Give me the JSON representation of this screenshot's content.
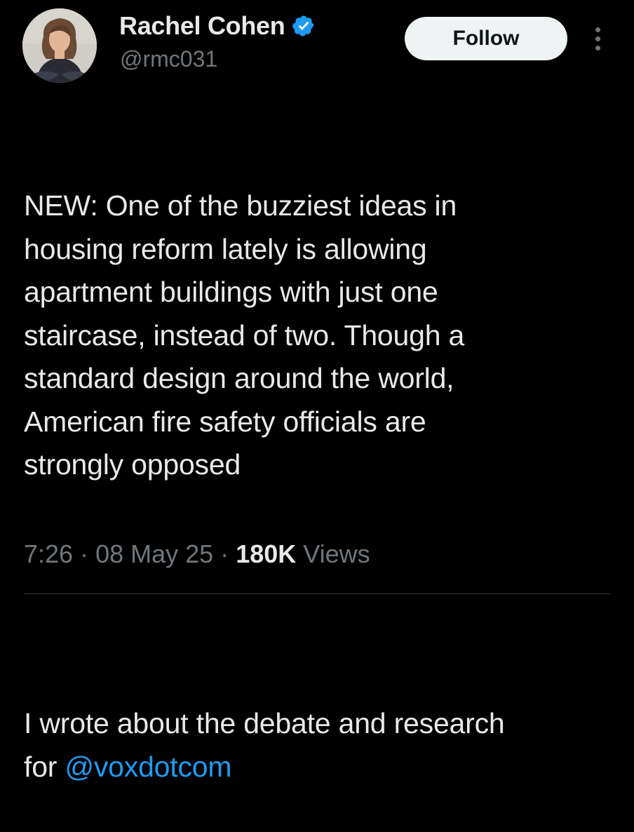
{
  "author": {
    "display_name": "Rachel Cohen",
    "handle": "@rmc031",
    "verified": true
  },
  "follow_button": {
    "label": "Follow"
  },
  "tweet": {
    "paragraph_1": "NEW: One of the buzziest ideas in\nhousing reform lately is allowing\napartment buildings with just one\nstaircase, instead of two. Though a\nstandard design around the world,\nAmerican fire safety officials are\nstrongly opposed",
    "paragraph_2_line_1": "I wrote about the debate and research",
    "paragraph_2_prefix": "for ",
    "mention": "@voxdotcom"
  },
  "meta": {
    "time": "7:26",
    "separator": " · ",
    "date": "08 May 25",
    "views_count": "180K",
    "views_label": " Views"
  },
  "icons": {
    "verified": "verified-badge-icon",
    "more": "more-vertical-icon"
  },
  "colors": {
    "background": "#000000",
    "text_primary": "#e7e9ea",
    "text_secondary": "#71767b",
    "accent": "#1d9bf0",
    "follow_bg": "#eff3f4"
  }
}
